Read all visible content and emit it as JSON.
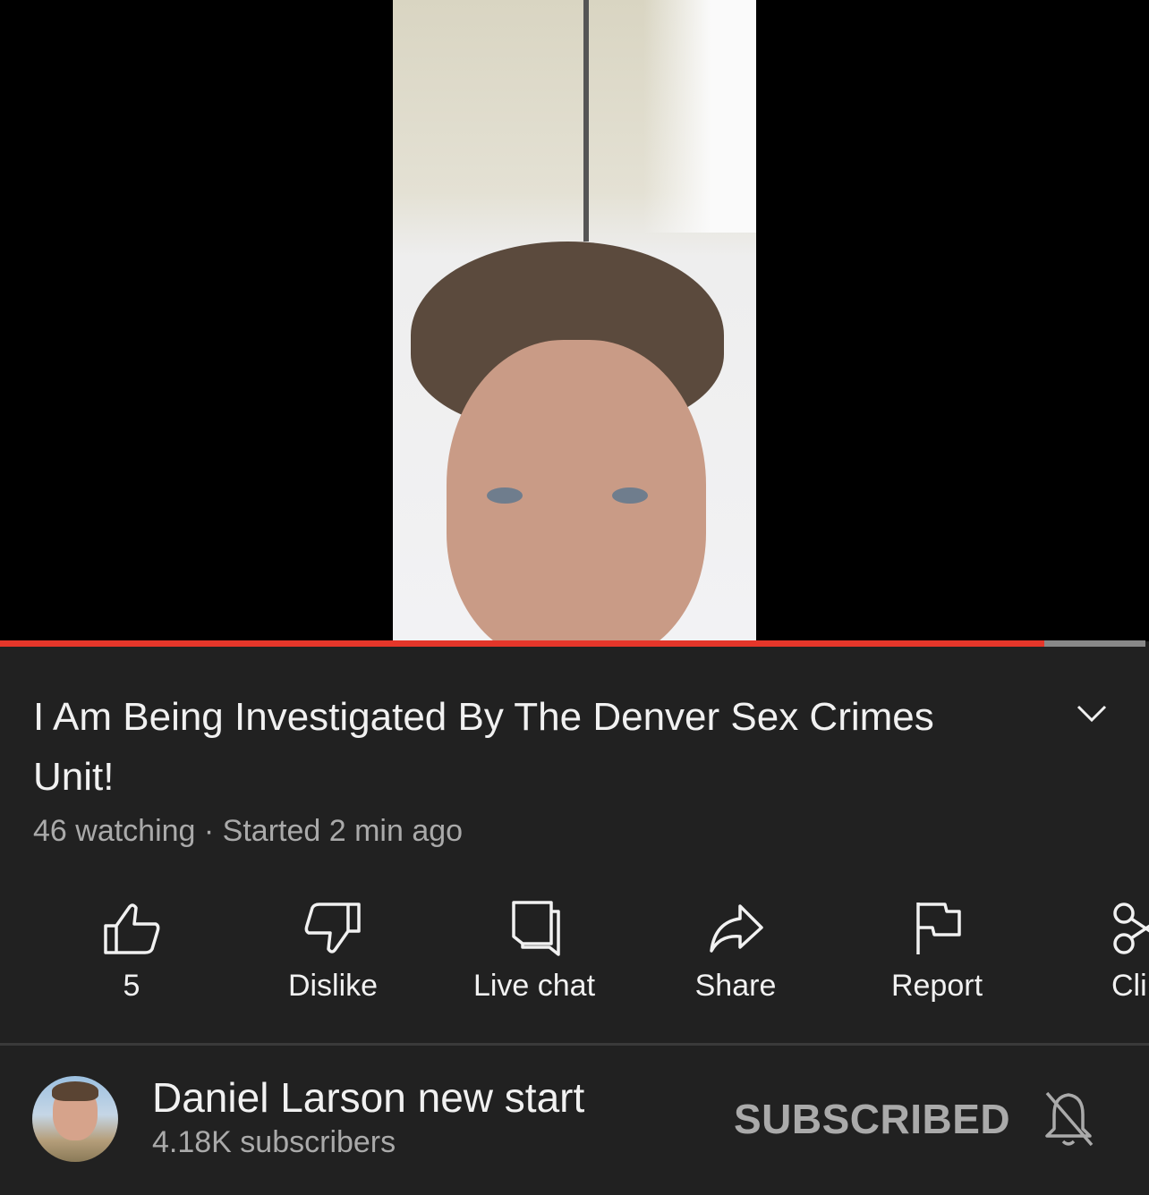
{
  "player": {
    "progress_fraction": 0.912,
    "colors": {
      "played": "#e5362a",
      "remaining": "#888888"
    }
  },
  "video": {
    "title": "I Am Being Investigated By The Denver Sex Crimes Unit!",
    "meta": "46 watching · Started 2 min ago",
    "expand_icon": "chevron-down-icon"
  },
  "actions": [
    {
      "icon": "thumbs-up-icon",
      "label": "5"
    },
    {
      "icon": "thumbs-down-icon",
      "label": "Dislike"
    },
    {
      "icon": "live-chat-icon",
      "label": "Live chat"
    },
    {
      "icon": "share-icon",
      "label": "Share"
    },
    {
      "icon": "flag-icon",
      "label": "Report"
    },
    {
      "icon": "scissors-icon",
      "label": "Cli"
    }
  ],
  "channel": {
    "name": "Daniel Larson new start",
    "subscribers": "4.18K subscribers",
    "subscribe_label": "SUBSCRIBED",
    "notification_icon": "bell-off-icon"
  }
}
